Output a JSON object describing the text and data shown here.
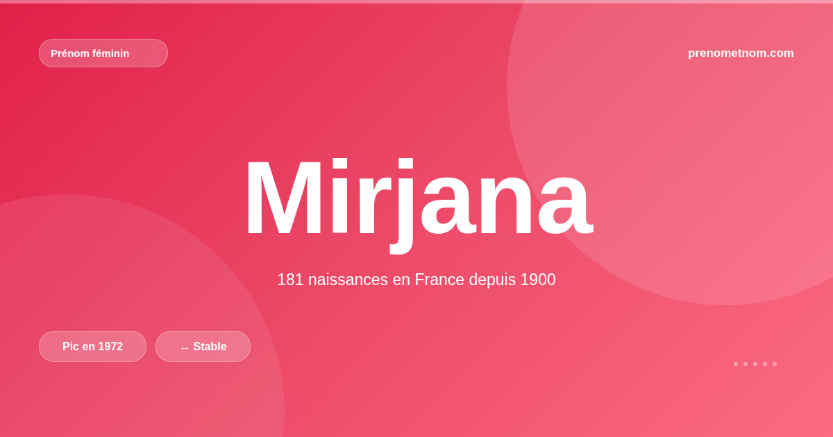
{
  "badge": "Prénom féminin",
  "site": "prenometnom.com",
  "name": "Mirjana",
  "subtitle": "181 naissances en France depuis 1900",
  "pills": [
    {
      "label": "Pic en 1972"
    },
    {
      "label": "↔ Stable"
    }
  ]
}
